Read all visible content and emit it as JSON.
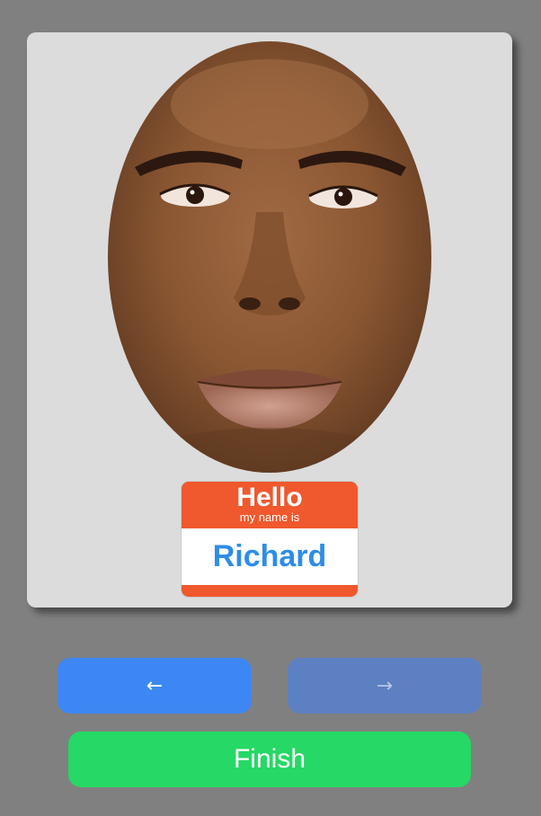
{
  "card": {
    "background": "#dcdcdc"
  },
  "name_tag": {
    "hello": "Hello",
    "subtitle": "my name is",
    "name": "Richard",
    "tag_color": "#f0582d",
    "name_color": "#2d8de8"
  },
  "nav": {
    "prev_label": "←",
    "next_label": "→",
    "finish_label": "Finish",
    "prev_color": "#3d87f5",
    "next_color": "#5c80c2",
    "finish_color": "#26d865"
  },
  "icons": {
    "prev": "arrow-left-icon",
    "next": "arrow-right-icon"
  }
}
